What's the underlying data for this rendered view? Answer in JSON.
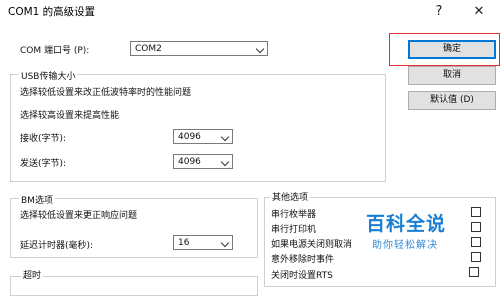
{
  "window": {
    "title": "COM1 的高级设置",
    "help": "?",
    "close": "✕"
  },
  "port": {
    "label": "COM 端口号 (P):",
    "value": "COM2"
  },
  "buttons": {
    "ok": "确定",
    "cancel": "取消",
    "default": "默认值 (D)"
  },
  "usb": {
    "title": "USB传输大小",
    "desc_low": "选择较低设置来改正低波特率时的性能问题",
    "desc_high": "选择较高设置来提高性能",
    "receive_label": "接收(字节):",
    "receive_value": "4096",
    "send_label": "发送(字节):",
    "send_value": "4096"
  },
  "bm": {
    "title": "BM选项",
    "desc": "选择较低设置来更正响应问题",
    "latency_label": "延迟计时器(毫秒):",
    "latency_value": "16"
  },
  "timeouts": {
    "title": "超时"
  },
  "misc": {
    "title": "其他选项",
    "items": [
      "串行枚举器",
      "串行打印机",
      "如果电源关闭则取消",
      "意外移除时事件",
      "关闭时设置RTS"
    ]
  },
  "watermark": {
    "title": "百科全说",
    "subtitle": "助你轻松解决"
  }
}
